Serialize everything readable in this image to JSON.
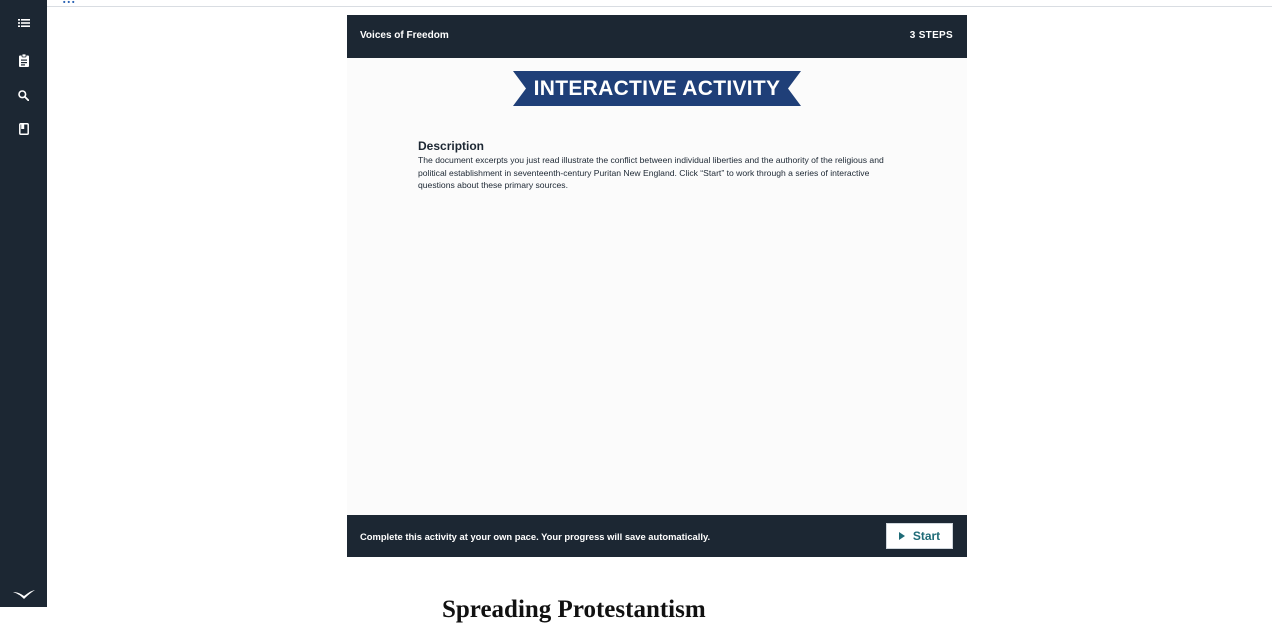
{
  "page": {
    "top_cut_text": "...",
    "section_heading": "Spreading Protestantism"
  },
  "sidebar": {
    "items": [
      {
        "icon": "list-icon"
      },
      {
        "icon": "clipboard-icon"
      },
      {
        "icon": "search-icon"
      },
      {
        "icon": "bookmark-icon"
      }
    ],
    "logo_icon": "bird-logo-icon"
  },
  "activity": {
    "title": "Voices of Freedom",
    "steps": "3 STEPS",
    "banner": "INTERACTIVE ACTIVITY",
    "description_heading": "Description",
    "description": "The document excerpts you just read illustrate the conflict between individual liberties and the authority of the religious and political establishment in seventeenth-century Puritan New England. Click “Start” to work through a series of interactive questions about these primary sources.",
    "footer_text": "Complete this activity at your own pace. Your progress will save automatically.",
    "start_label": "Start"
  },
  "colors": {
    "sidebar_bg": "#1c2733",
    "banner_blue": "#1f3f78",
    "start_text": "#1f6b77"
  }
}
